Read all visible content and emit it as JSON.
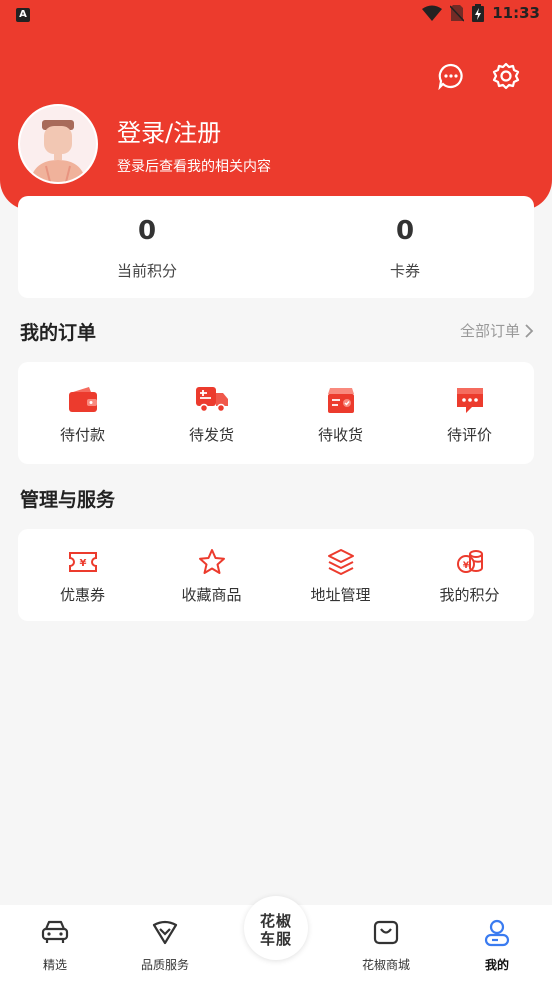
{
  "status_bar": {
    "time": "11:33",
    "app_badge": "A"
  },
  "header": {
    "login_title": "登录/注册",
    "login_subtitle": "登录后查看我的相关内容"
  },
  "points": [
    {
      "value": "0",
      "label": "当前积分"
    },
    {
      "value": "0",
      "label": "卡券"
    }
  ],
  "orders": {
    "title": "我的订单",
    "all_label": "全部订单",
    "items": [
      {
        "label": "待付款",
        "icon": "wallet-icon"
      },
      {
        "label": "待发货",
        "icon": "truck-icon"
      },
      {
        "label": "待收货",
        "icon": "package-icon"
      },
      {
        "label": "待评价",
        "icon": "comment-icon"
      }
    ]
  },
  "services": {
    "title": "管理与服务",
    "items": [
      {
        "label": "优惠券",
        "icon": "coupon-icon"
      },
      {
        "label": "收藏商品",
        "icon": "star-icon"
      },
      {
        "label": "地址管理",
        "icon": "layers-icon"
      },
      {
        "label": "我的积分",
        "icon": "coins-icon"
      }
    ]
  },
  "tabbar": {
    "items": [
      {
        "label": "精选",
        "icon": "car-icon"
      },
      {
        "label": "品质服务",
        "icon": "shield-check-icon"
      },
      {
        "label": "花椒商城",
        "icon": "shopping-bag-icon"
      },
      {
        "label": "我的",
        "icon": "user-icon"
      }
    ],
    "center_logo_line1": "花椒",
    "center_logo_line2": "车服",
    "active": "我的"
  },
  "colors": {
    "brand_red": "#ec3b2d",
    "active_blue": "#3a7bf0"
  }
}
